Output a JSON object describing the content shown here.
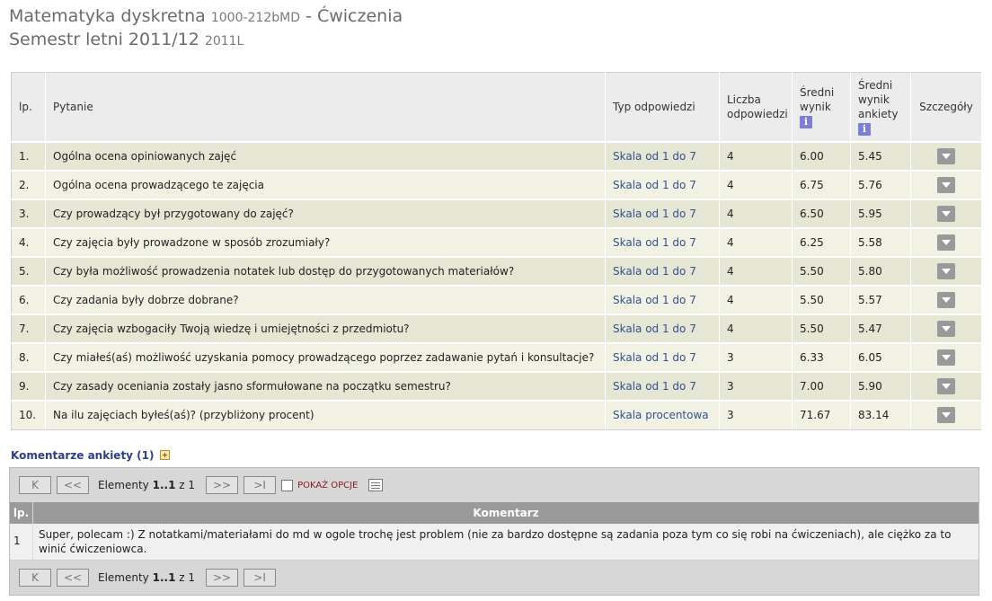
{
  "header": {
    "course_name": "Matematyka dyskretna",
    "course_code": "1000-212bMD",
    "separator": "-",
    "class_type": "Ćwiczenia",
    "semester": "Semestr letni 2011/12",
    "semester_code": "2011L"
  },
  "results_table": {
    "columns": {
      "lp": "lp.",
      "question": "Pytanie",
      "type": "Typ odpowiedzi",
      "count": "Liczba odpowiedzi",
      "avg_score": "Średni wynik",
      "avg_survey": "Średni wynik ankiety",
      "details": "Szczegóły"
    },
    "info_icon_glyph": "i",
    "rows": [
      {
        "lp": "1.",
        "question": "Ogólna ocena opiniowanych zajęć",
        "type": "Skala od 1 do 7",
        "count": "4",
        "avg": "6.00",
        "survey": "5.45"
      },
      {
        "lp": "2.",
        "question": "Ogólna ocena prowadzącego te zajęcia",
        "type": "Skala od 1 do 7",
        "count": "4",
        "avg": "6.75",
        "survey": "5.76"
      },
      {
        "lp": "3.",
        "question": "Czy prowadzący był przygotowany do zajęć?",
        "type": "Skala od 1 do 7",
        "count": "4",
        "avg": "6.50",
        "survey": "5.95"
      },
      {
        "lp": "4.",
        "question": "Czy zajęcia były prowadzone w sposób zrozumiały?",
        "type": "Skala od 1 do 7",
        "count": "4",
        "avg": "6.25",
        "survey": "5.58"
      },
      {
        "lp": "5.",
        "question": "Czy była możliwość prowadzenia notatek lub dostęp do przygotowanych materiałów?",
        "type": "Skala od 1 do 7",
        "count": "4",
        "avg": "5.50",
        "survey": "5.80"
      },
      {
        "lp": "6.",
        "question": "Czy zadania były dobrze dobrane?",
        "type": "Skala od 1 do 7",
        "count": "4",
        "avg": "5.50",
        "survey": "5.57"
      },
      {
        "lp": "7.",
        "question": "Czy zajęcia wzbogaciły Twoją wiedzę i umiejętności z przedmiotu?",
        "type": "Skala od 1 do 7",
        "count": "4",
        "avg": "5.50",
        "survey": "5.47"
      },
      {
        "lp": "8.",
        "question": "Czy miałeś(aś) możliwość uzyskania pomocy prowadzącego poprzez zadawanie pytań i konsultacje?",
        "type": "Skala od 1 do 7",
        "count": "3",
        "avg": "6.33",
        "survey": "6.05"
      },
      {
        "lp": "9.",
        "question": "Czy zasady oceniania zostały jasno sformułowane na początku semestru?",
        "type": "Skala od 1 do 7",
        "count": "3",
        "avg": "7.00",
        "survey": "5.90"
      },
      {
        "lp": "10.",
        "question": "Na ilu zajęciach byłeś(aś)? (przybliżony procent)",
        "type": "Skala procentowa",
        "count": "3",
        "avg": "71.67",
        "survey": "83.14"
      }
    ]
  },
  "comments": {
    "title": "Komentarze ankiety (1)",
    "pager": {
      "first": "K",
      "prev": "<<",
      "next": ">>",
      "last": ">I",
      "elements_label": "Elementy",
      "range": "1..1",
      "of_label": "z",
      "total": "1",
      "options_label": "POKAŻ OPCJE"
    },
    "columns": {
      "lp": "lp.",
      "comment": "Komentarz"
    },
    "rows": [
      {
        "lp": "1",
        "text": "Super, polecam :) Z notatkami/materiałami do md w ogole trochę jest problem (nie za bardzo dostępne są zadania poza tym co się robi na ćwiczeniach), ale ciężko za to winić ćwiczeniowca."
      }
    ]
  }
}
